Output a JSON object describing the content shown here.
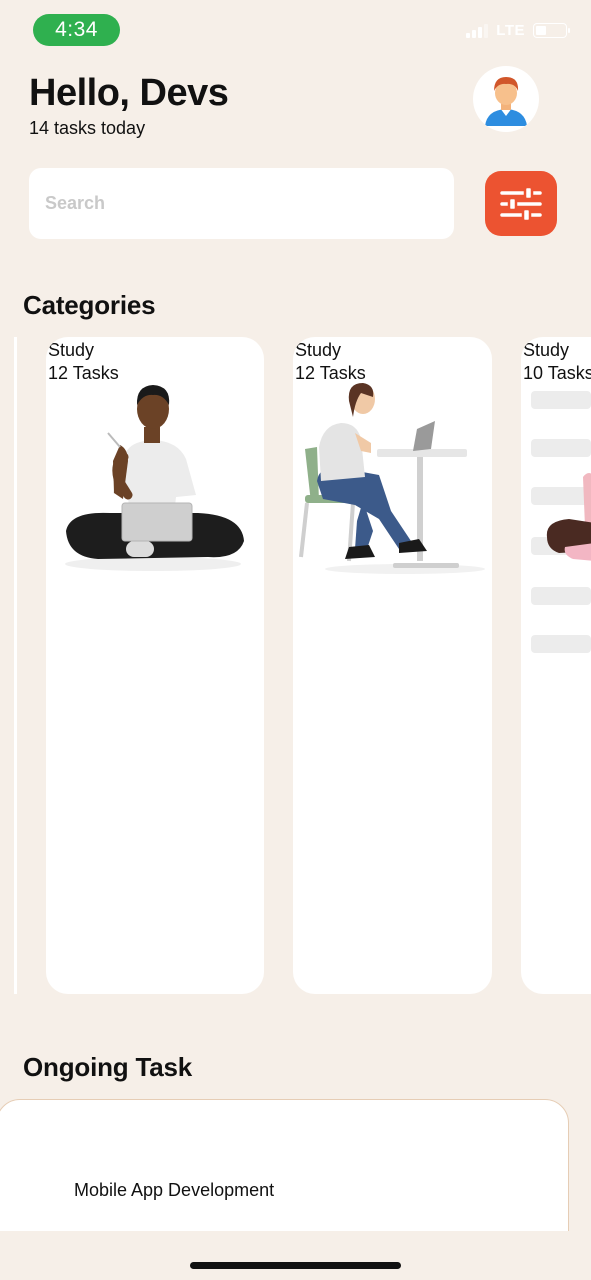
{
  "status_bar": {
    "time": "4:34",
    "network": "LTE"
  },
  "header": {
    "greeting": "Hello, Devs",
    "subtitle": "14 tasks today"
  },
  "search": {
    "placeholder": "Search",
    "value": ""
  },
  "icons": {
    "avatar": "avatar-icon",
    "filter": "sliders-icon",
    "signal": "signal-icon",
    "battery": "battery-icon"
  },
  "colors": {
    "background": "#f6efe8",
    "accent": "#ec5331",
    "time_pill": "#2fb04f",
    "card": "#ffffff"
  },
  "categories": {
    "title": "Categories",
    "items": [
      {
        "title": "Study",
        "count": "12 Tasks"
      },
      {
        "title": "Study",
        "count": "12 Tasks"
      },
      {
        "title": "Study",
        "count": "10 Tasks"
      }
    ]
  },
  "ongoing": {
    "title": "Ongoing Task",
    "items": [
      {
        "title": "Mobile App Development"
      }
    ]
  }
}
